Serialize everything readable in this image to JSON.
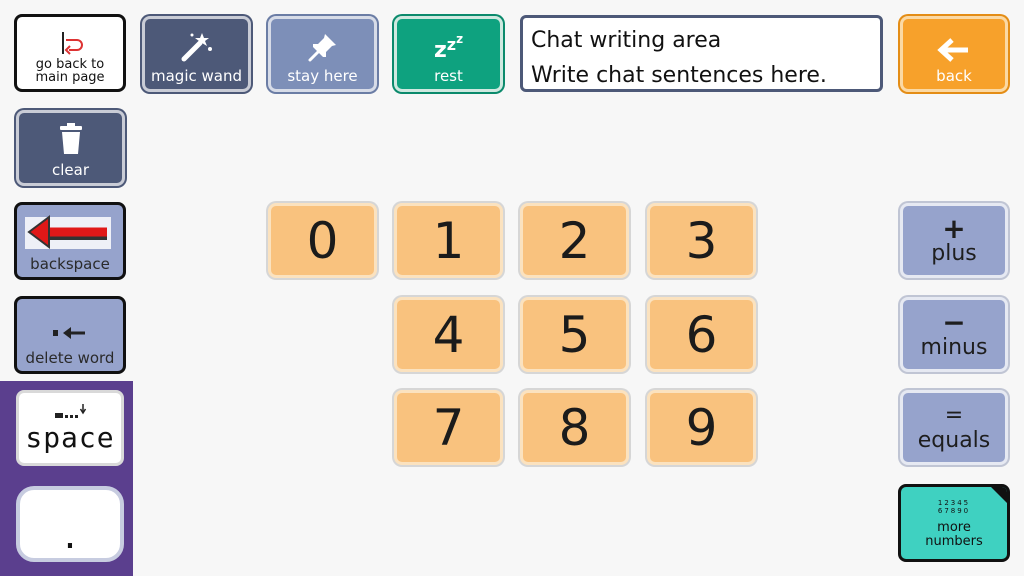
{
  "toolbar": {
    "main_page_label": "go back to main page",
    "magic_wand_label": "magic wand",
    "stay_here_label": "stay here",
    "rest_label": "rest",
    "back_label": "back"
  },
  "chat": {
    "title": "Chat writing area",
    "placeholder": "Write chat sentences here."
  },
  "sidebar": {
    "clear_label": "clear",
    "backspace_label": "backspace",
    "delete_word_label": "delete word",
    "space_label": "space",
    "period_label": "."
  },
  "digits": [
    "0",
    "1",
    "2",
    "3",
    "4",
    "5",
    "6",
    "7",
    "8",
    "9"
  ],
  "operators": {
    "plus": {
      "symbol": "+",
      "label": "plus"
    },
    "minus": {
      "symbol": "−",
      "label": "minus"
    },
    "equals": {
      "symbol": "=",
      "label": "equals"
    }
  },
  "more_numbers": {
    "preview_line1": "12345",
    "preview_line2": "67890",
    "label": "more numbers"
  },
  "icons": {
    "main_page": "return-arrow-icon",
    "magic_wand": "magic-wand-icon",
    "stay_here": "pushpin-icon",
    "rest": "sleep-zzz-icon",
    "back": "left-arrow-icon",
    "clear": "trash-icon",
    "backspace": "red-left-arrow-icon",
    "delete_word": "delete-word-icon",
    "space": "space-icon"
  },
  "colors": {
    "navy": "#4d5978",
    "teal": "#0ea27f",
    "orange": "#f7a12b",
    "number_key": "#f9c27e",
    "operator_key": "#96a3cc",
    "more_numbers": "#3fd1c1",
    "purple_panel": "#5b3f8e"
  }
}
